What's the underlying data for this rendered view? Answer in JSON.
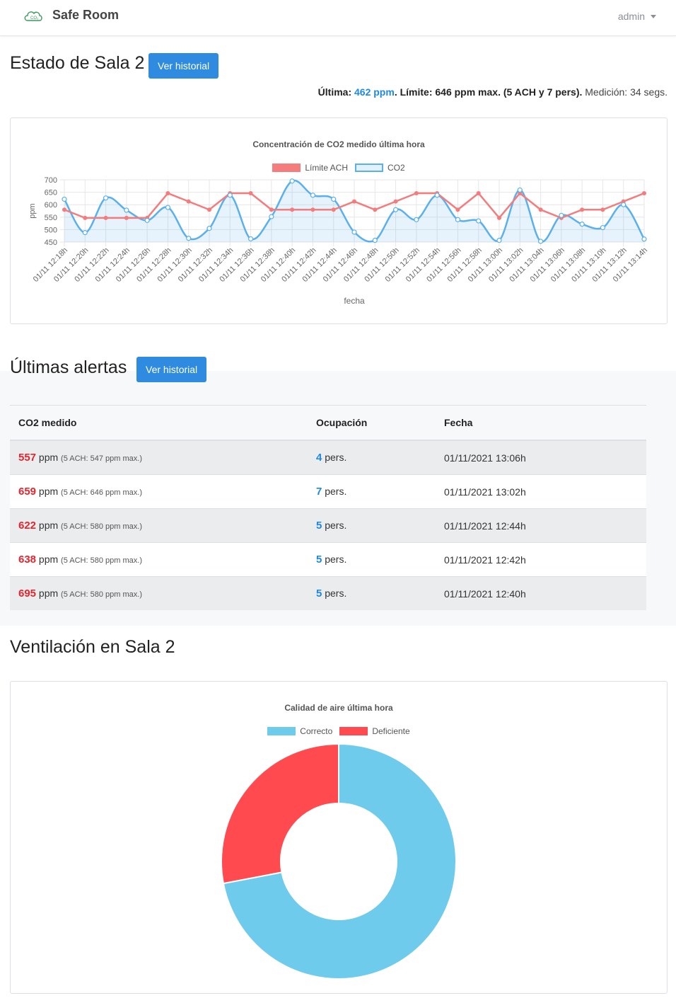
{
  "navbar": {
    "brand_name": "Safe Room",
    "user": "admin",
    "logo_icon": "co2-cloud-icon"
  },
  "status": {
    "title": "Estado de Sala 2",
    "history_button": "Ver historial",
    "last_label": "Última:",
    "last_value": "462 ppm",
    "limit_text": ". Límite: 646 ppm max. (5 ACH y 7 pers).",
    "measurement": " Medición: 34 segs."
  },
  "co2_chart": {
    "chart_data": {
      "type": "line",
      "title": "Concentración de CO2 medido última hora",
      "xlabel": "fecha",
      "ylabel": "ppm",
      "ylim": [
        450,
        700
      ],
      "yticks": [
        450,
        500,
        550,
        600,
        650,
        700
      ],
      "categories": [
        "01/11 12:18h",
        "01/11 12:20h",
        "01/11 12:22h",
        "01/11 12:24h",
        "01/11 12:26h",
        "01/11 12:28h",
        "01/11 12:30h",
        "01/11 12:32h",
        "01/11 12:34h",
        "01/11 12:36h",
        "01/11 12:38h",
        "01/11 12:40h",
        "01/11 12:42h",
        "01/11 12:44h",
        "01/11 12:46h",
        "01/11 12:48h",
        "01/11 12:50h",
        "01/11 12:52h",
        "01/11 12:54h",
        "01/11 12:56h",
        "01/11 12:58h",
        "01/11 13:00h",
        "01/11 13:02h",
        "01/11 13:04h",
        "01/11 13:06h",
        "01/11 13:08h",
        "01/11 13:10h",
        "01/11 13:12h",
        "01/11 13:14h"
      ],
      "series": [
        {
          "name": "Límite ACH",
          "color": "#f47c7c",
          "values": [
            580,
            547,
            547,
            547,
            547,
            646,
            613,
            580,
            646,
            646,
            580,
            580,
            580,
            580,
            613,
            580,
            613,
            646,
            646,
            580,
            646,
            547,
            646,
            580,
            547,
            580,
            580,
            613,
            646
          ]
        },
        {
          "name": "CO2",
          "color": "#5ab0ee",
          "values": [
            622,
            488,
            627,
            578,
            537,
            589,
            465,
            505,
            638,
            463,
            552,
            695,
            638,
            622,
            490,
            457,
            580,
            540,
            638,
            540,
            535,
            457,
            659,
            453,
            557,
            522,
            508,
            600,
            462
          ]
        }
      ],
      "grid": true,
      "legend": "top"
    }
  },
  "alerts": {
    "title": "Últimas alertas",
    "history_button": "Ver historial",
    "columns": [
      "CO2 medido",
      "Ocupación",
      "Fecha"
    ],
    "rows": [
      {
        "co2": "557",
        "unit": " ppm ",
        "detail": "(5 ACH: 547 ppm max.)",
        "occupancy": "4",
        "occ_unit": " pers.",
        "date": "01/11/2021 13:06h"
      },
      {
        "co2": "659",
        "unit": " ppm ",
        "detail": "(5 ACH: 646 ppm max.)",
        "occupancy": "7",
        "occ_unit": " pers.",
        "date": "01/11/2021 13:02h"
      },
      {
        "co2": "622",
        "unit": " ppm ",
        "detail": "(5 ACH: 580 ppm max.)",
        "occupancy": "5",
        "occ_unit": " pers.",
        "date": "01/11/2021 12:44h"
      },
      {
        "co2": "638",
        "unit": " ppm ",
        "detail": "(5 ACH: 580 ppm max.)",
        "occupancy": "5",
        "occ_unit": " pers.",
        "date": "01/11/2021 12:42h"
      },
      {
        "co2": "695",
        "unit": " ppm ",
        "detail": "(5 ACH: 580 ppm max.)",
        "occupancy": "5",
        "occ_unit": " pers.",
        "date": "01/11/2021 12:40h"
      }
    ]
  },
  "ventilation": {
    "title": "Ventilación en Sala 2",
    "chart_data": {
      "type": "pie",
      "title": "Calidad de aire última hora",
      "categories": [
        "Correcto",
        "Deficiente"
      ],
      "values": [
        72,
        28
      ],
      "colors": [
        "#6ecbeb",
        "#ff4b4f"
      ],
      "legend": "top"
    }
  }
}
